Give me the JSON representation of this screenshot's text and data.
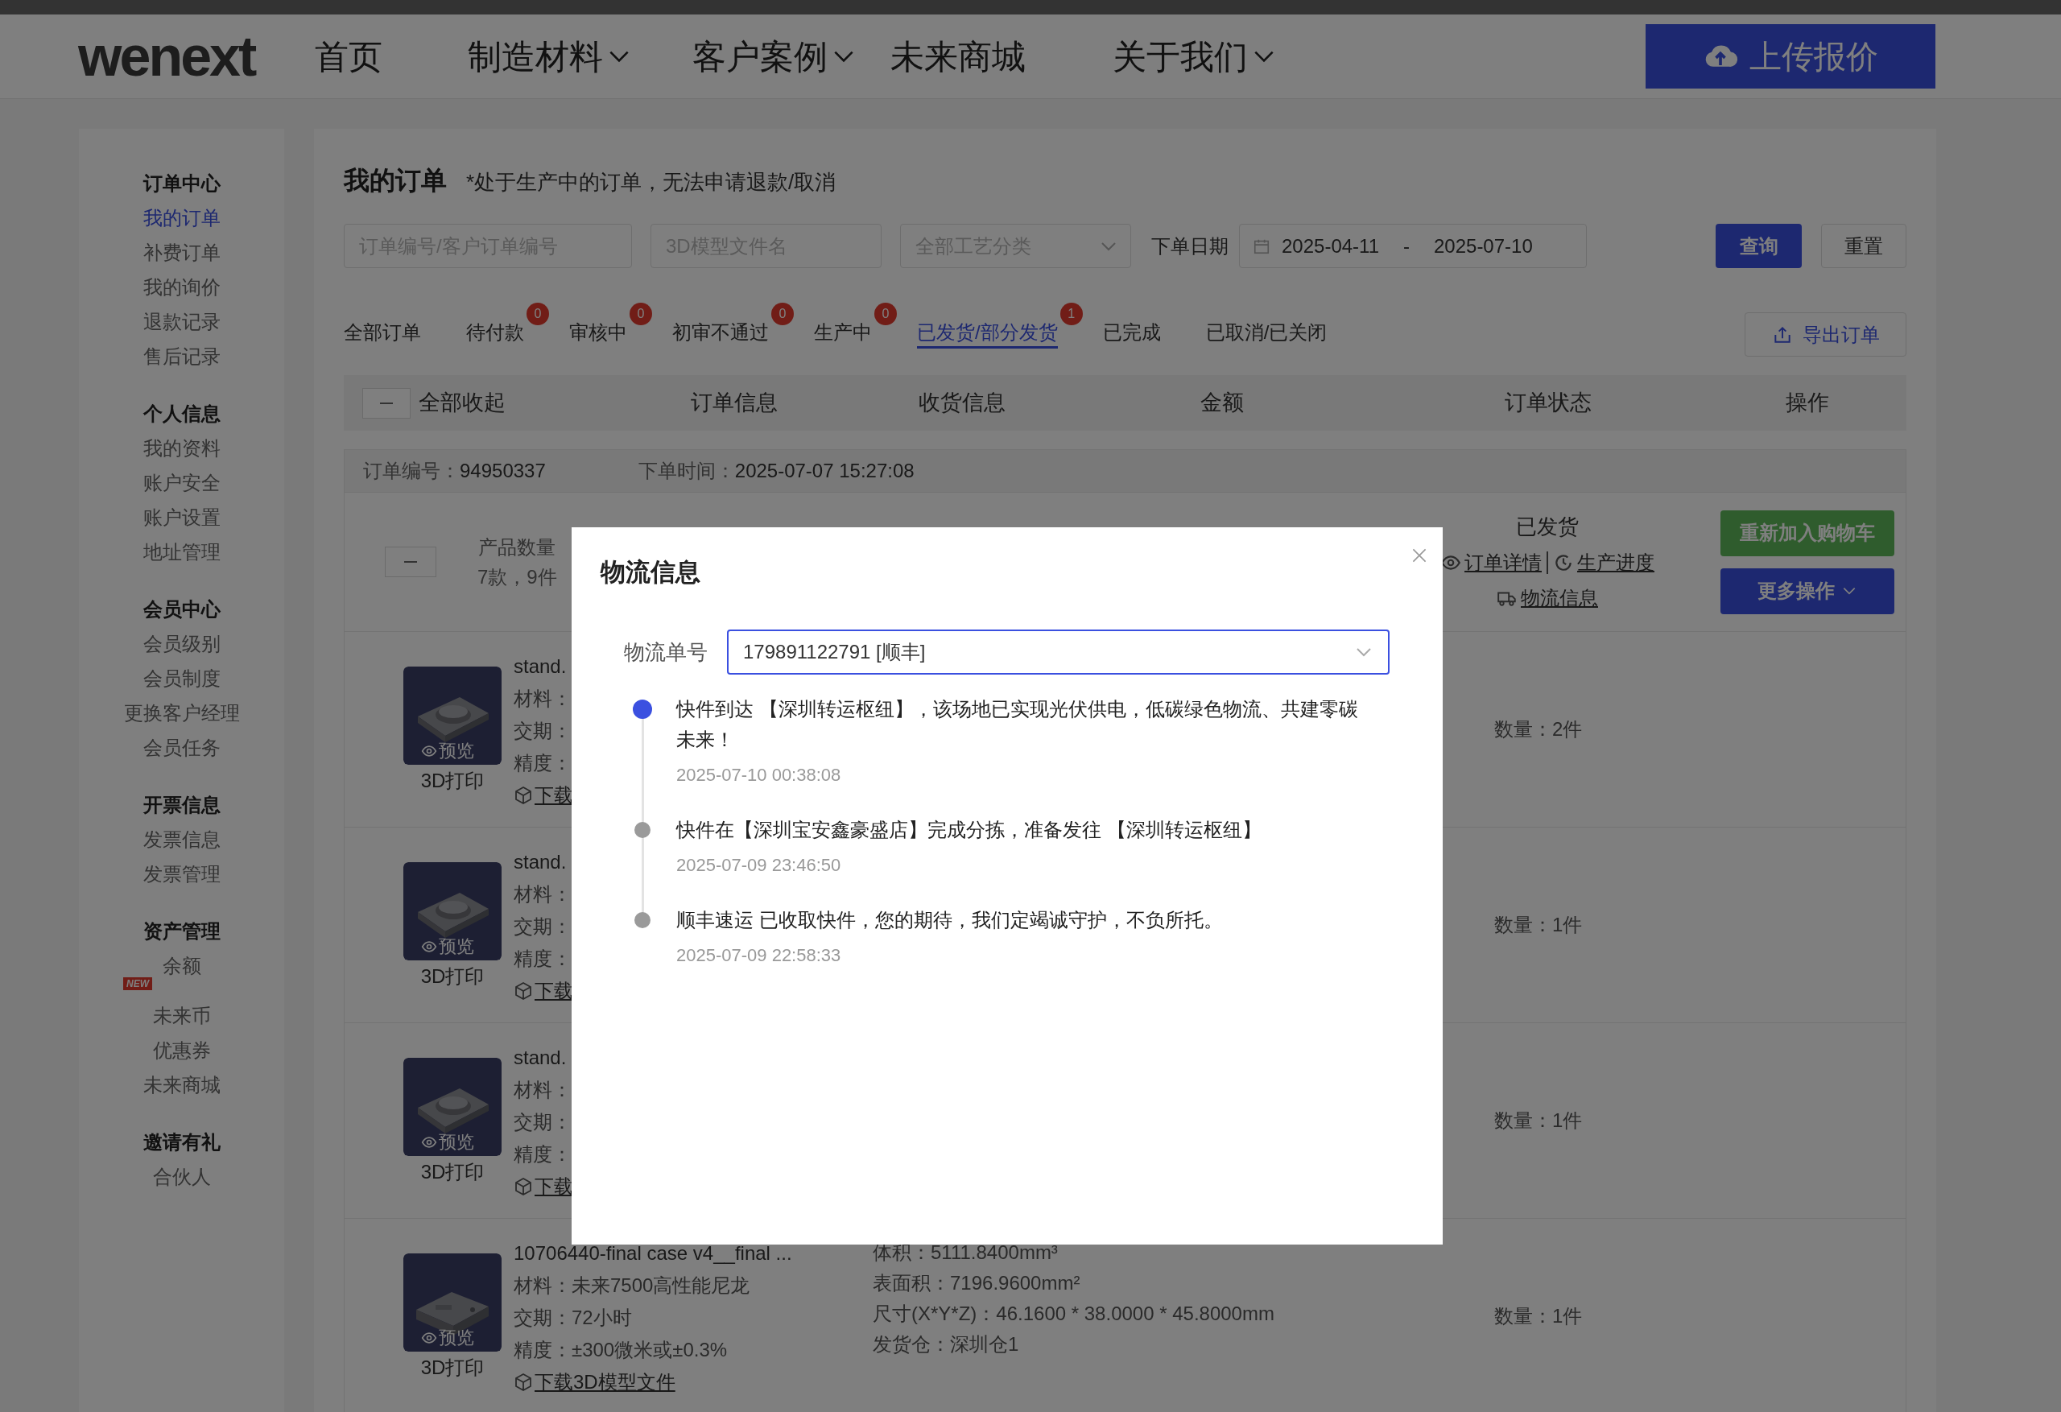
{
  "nav": {
    "logo": "wenext",
    "items": [
      {
        "label": "首页",
        "dropdown": false
      },
      {
        "label": "制造材料",
        "dropdown": true
      },
      {
        "label": "客户案例",
        "dropdown": true
      },
      {
        "label": "未来商城",
        "dropdown": false
      },
      {
        "label": "关于我们",
        "dropdown": true
      }
    ],
    "upload_button": "上传报价"
  },
  "sidebar": {
    "groups": [
      {
        "title": "订单中心",
        "items": [
          {
            "label": "我的订单",
            "selected": true
          },
          {
            "label": "补费订单",
            "selected": false
          },
          {
            "label": "我的询价",
            "selected": false
          },
          {
            "label": "退款记录",
            "selected": false
          },
          {
            "label": "售后记录",
            "selected": false
          }
        ]
      },
      {
        "title": "个人信息",
        "items": [
          {
            "label": "我的资料",
            "selected": false
          },
          {
            "label": "账户安全",
            "selected": false
          },
          {
            "label": "账户设置",
            "selected": false
          },
          {
            "label": "地址管理",
            "selected": false
          }
        ]
      },
      {
        "title": "会员中心",
        "items": [
          {
            "label": "会员级别",
            "selected": false
          },
          {
            "label": "会员制度",
            "selected": false
          },
          {
            "label": "更换客户经理",
            "selected": false
          },
          {
            "label": "会员任务",
            "selected": false
          }
        ]
      },
      {
        "title": "开票信息",
        "items": [
          {
            "label": "发票信息",
            "selected": false
          },
          {
            "label": "发票管理",
            "selected": false
          }
        ]
      },
      {
        "title": "资产管理",
        "items": [
          {
            "label": "余额",
            "selected": false,
            "badge": "NEW"
          },
          {
            "label": "未来币",
            "selected": false
          },
          {
            "label": "优惠券",
            "selected": false
          },
          {
            "label": "未来商城",
            "selected": false
          }
        ]
      },
      {
        "title": "邀请有礼",
        "items": [
          {
            "label": "合伙人",
            "selected": false
          }
        ]
      }
    ]
  },
  "page": {
    "title": "我的订单",
    "note": "*处于生产中的订单，无法申请退款/取消"
  },
  "filters": {
    "order_no": {
      "placeholder": "订单编号/客户订单编号"
    },
    "model_file": {
      "placeholder": "3D模型文件名"
    },
    "process": {
      "placeholder": "全部工艺分类"
    },
    "date_label": "下单日期",
    "date_start": "2025-04-11",
    "date_separator": "-",
    "date_end": "2025-07-10",
    "query_button": "查询",
    "reset_button": "重置"
  },
  "tabs": [
    {
      "label": "全部订单",
      "selected": false
    },
    {
      "label": "待付款",
      "badge": "0",
      "selected": false
    },
    {
      "label": "审核中",
      "badge": "0",
      "selected": false
    },
    {
      "label": "初审不通过",
      "badge": "0",
      "selected": false
    },
    {
      "label": "生产中",
      "badge": "0",
      "selected": false
    },
    {
      "label": "已发货/部分发货",
      "badge": "1",
      "selected": true
    },
    {
      "label": "已完成",
      "selected": false
    },
    {
      "label": "已取消/已关闭",
      "selected": false
    }
  ],
  "export_button": "导出订单",
  "table": {
    "expanded": true,
    "collapse_label": "全部收起",
    "columns": [
      "订单信息",
      "收货信息",
      "金额",
      "订单状态",
      "操作"
    ]
  },
  "order": {
    "expanded": true,
    "number_label": "订单编号：",
    "number": "94950337",
    "time_label": "下单时间：",
    "time": "2025-07-07 15:27:08",
    "count_label": "产品数量",
    "count": "7款，9件",
    "status": "已发货",
    "links": [
      {
        "label": "订单详情",
        "kind": "eye"
      },
      {
        "label": "生产进度",
        "kind": "clock"
      },
      {
        "label": "物流信息",
        "kind": "truck"
      }
    ],
    "buttons": [
      {
        "label": "重新加入购物车",
        "kind": "reorder"
      },
      {
        "label": "更多操作",
        "kind": "more"
      }
    ],
    "items": [
      {
        "name": "stand.",
        "preview": "预览",
        "process": "3D打印",
        "details": [
          "材料：",
          "交期：",
          "精度："
        ],
        "download": "下载",
        "quantity": "数量：2件"
      },
      {
        "name": "stand.",
        "preview": "预览",
        "process": "3D打印",
        "details": [
          "材料：",
          "交期：",
          "精度："
        ],
        "download": "下载",
        "quantity": "数量：1件"
      },
      {
        "name": "stand.",
        "preview": "预览",
        "process": "3D打印",
        "details": [
          "材料：",
          "交期：",
          "精度："
        ],
        "download": "下载",
        "quantity": "数量：1件"
      },
      {
        "name": "10706440-final case v4__final ...",
        "preview": "预览",
        "process": "3D打印",
        "details": [
          "材料：未来7500高性能尼龙",
          "交期：72小时",
          "精度：±300微米或±0.3%"
        ],
        "download": "下载3D模型文件",
        "specs": [
          "体积：5111.8400mm³",
          "表面积：7196.9600mm²",
          "尺寸(X*Y*Z)：46.1600 * 38.0000 * 45.8000mm",
          "发货仓：深圳仓1"
        ],
        "quantity": "数量：1件"
      }
    ]
  },
  "modal": {
    "title": "物流信息",
    "tracking_label": "物流单号",
    "tracking_value": "179891122791 [顺丰]",
    "events": [
      {
        "text": "快件到达 【深圳转运枢纽】，该场地已实现光伏供电，低碳绿色物流、共建零碳未来！",
        "time": "2025-07-10 00:38:08",
        "current": true
      },
      {
        "text": "快件在【深圳宝安鑫豪盛店】完成分拣，准备发往 【深圳转运枢纽】",
        "time": "2025-07-09 23:46:50",
        "current": false
      },
      {
        "text": "顺丰速运 已收取快件，您的期待，我们定竭诚守护，不负所托。",
        "time": "2025-07-09 22:58:33",
        "current": false
      }
    ]
  }
}
